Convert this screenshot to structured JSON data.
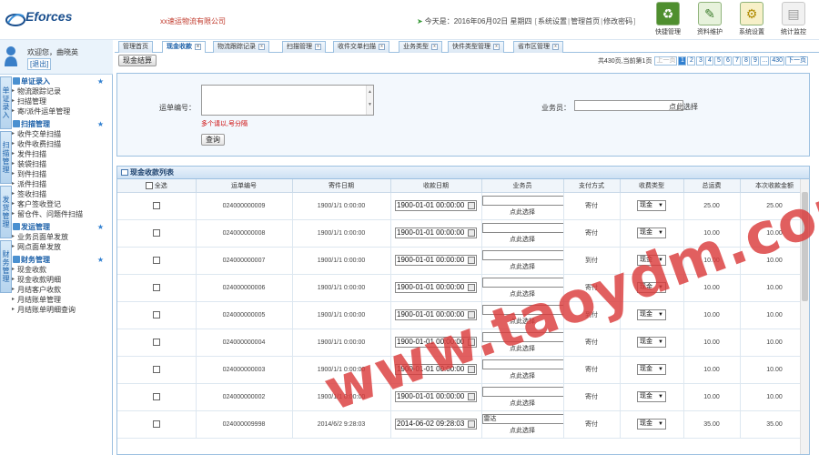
{
  "header": {
    "brand": "Eforces",
    "brand_sub": "",
    "company": "xx速运物流有限公司",
    "topline": {
      "prefix": "今天是：",
      "date": "2016年06月02日 星期四",
      "links": [
        "系统设置",
        "管理首页",
        "修改密码"
      ]
    },
    "quick_links": [
      {
        "label": "快捷管理",
        "icon": "recycle-icon"
      },
      {
        "label": "资料维护",
        "icon": "edit-icon"
      },
      {
        "label": "系统设置",
        "icon": "gears-icon"
      },
      {
        "label": "统计监控",
        "icon": "chart-icon"
      }
    ]
  },
  "user": {
    "welcome": "欢迎您，曲晓英",
    "logout": "[退出]"
  },
  "vertical_tabs": [
    "单证录入",
    "扫描管理",
    "发货管理",
    "财务管理"
  ],
  "menu": [
    {
      "title": "单证录入",
      "items": [
        "物流跟踪记录",
        "扫描管理",
        "寄/派件运单管理"
      ]
    },
    {
      "title": "扫描管理",
      "items": [
        "收件交单扫描",
        "收件收费扫描",
        "发件扫描",
        "装袋扫描",
        "到件扫描",
        "派件扫描",
        "签收扫描",
        "客户签收登记",
        "留仓件、问题件扫描"
      ]
    },
    {
      "title": "发运管理",
      "items": [
        "业务员面单发放",
        "网点面单发放"
      ]
    },
    {
      "title": "财务管理",
      "items": [
        "现金收款",
        "现金收款明细",
        "月结客户收款",
        "月结账单管理",
        "月结账单明细查询"
      ]
    }
  ],
  "tabs": [
    {
      "label": "管理首页",
      "closable": false
    },
    {
      "label": "现金收款",
      "closable": true,
      "active": true
    },
    {
      "label": "物流跟踪记录",
      "closable": true
    },
    {
      "label": "扫描管理",
      "closable": true
    },
    {
      "label": "收件交单扫描",
      "closable": true
    },
    {
      "label": "业务类型",
      "closable": true
    },
    {
      "label": "快件类型管理",
      "closable": true
    },
    {
      "label": "省市区管理",
      "closable": true
    }
  ],
  "toolbar": {
    "settle_label": "现金结算"
  },
  "pager": {
    "summary": "共430页,当前第1页",
    "prev": "上一页",
    "pages": [
      "1",
      "2",
      "3",
      "4",
      "5",
      "6",
      "7",
      "8",
      "9",
      "...",
      "430"
    ],
    "next": "下一页",
    "current": "1"
  },
  "search": {
    "waybill_label": "运单编号：",
    "waybill_value": "",
    "hint": "多个请以,号分隔",
    "query_label": "查询",
    "salesman_label": "业务员：",
    "salesman_value": "",
    "pick_label": "点此选择"
  },
  "grid": {
    "title": "现金收款列表",
    "columns": [
      "全选",
      "运单编号",
      "寄件日期",
      "收款日期",
      "业务员",
      "支付方式",
      "收费类型",
      "总运费",
      "本次收款金额"
    ],
    "pick_label": "点此选择",
    "rows": [
      {
        "no": "024000000009",
        "send": "1900/1/1 0:00:00",
        "recv": "1900-01-01 00:00:00",
        "salesman": "",
        "pay": "寄付",
        "fee": "现金",
        "total": "25.00",
        "amount": "25.00"
      },
      {
        "no": "024000000008",
        "send": "1900/1/1 0:00:00",
        "recv": "1900-01-01 00:00:00",
        "salesman": "",
        "pay": "寄付",
        "fee": "现金",
        "total": "10.00",
        "amount": "10.00"
      },
      {
        "no": "024000000007",
        "send": "1900/1/1 0:00:00",
        "recv": "1900-01-01 00:00:00",
        "salesman": "",
        "pay": "到付",
        "fee": "现金",
        "total": "10.00",
        "amount": "10.00"
      },
      {
        "no": "024000000006",
        "send": "1900/1/1 0:00:00",
        "recv": "1900-01-01 00:00:00",
        "salesman": "",
        "pay": "寄付",
        "fee": "现金",
        "total": "10.00",
        "amount": "10.00"
      },
      {
        "no": "024000000005",
        "send": "1900/1/1 0:00:00",
        "recv": "1900-01-01 00:00:00",
        "salesman": "",
        "pay": "到付",
        "fee": "现金",
        "total": "10.00",
        "amount": "10.00"
      },
      {
        "no": "024000000004",
        "send": "1900/1/1 0:00:00",
        "recv": "1900-01-01 00:00:00",
        "salesman": "",
        "pay": "寄付",
        "fee": "现金",
        "total": "10.00",
        "amount": "10.00"
      },
      {
        "no": "024000000003",
        "send": "1900/1/1 0:00:00",
        "recv": "1900-01-01 00:00:00",
        "salesman": "",
        "pay": "寄付",
        "fee": "现金",
        "total": "10.00",
        "amount": "10.00"
      },
      {
        "no": "024000000002",
        "send": "1900/1/1 0:00:00",
        "recv": "1900-01-01 00:00:00",
        "salesman": "",
        "pay": "寄付",
        "fee": "现金",
        "total": "10.00",
        "amount": "10.00"
      },
      {
        "no": "024000009998",
        "send": "2014/6/2 9:28:03",
        "recv": "2014-06-02 09:28:03",
        "salesman": "雷达",
        "pay": "寄付",
        "fee": "现金",
        "total": "35.00",
        "amount": "35.00"
      }
    ]
  },
  "watermark": "www.taoydm.com",
  "colors": {
    "accent": "#2f7fd0",
    "border": "#9cc0e0",
    "hint_red": "#cc0000",
    "watermark": "#da3c3c"
  }
}
